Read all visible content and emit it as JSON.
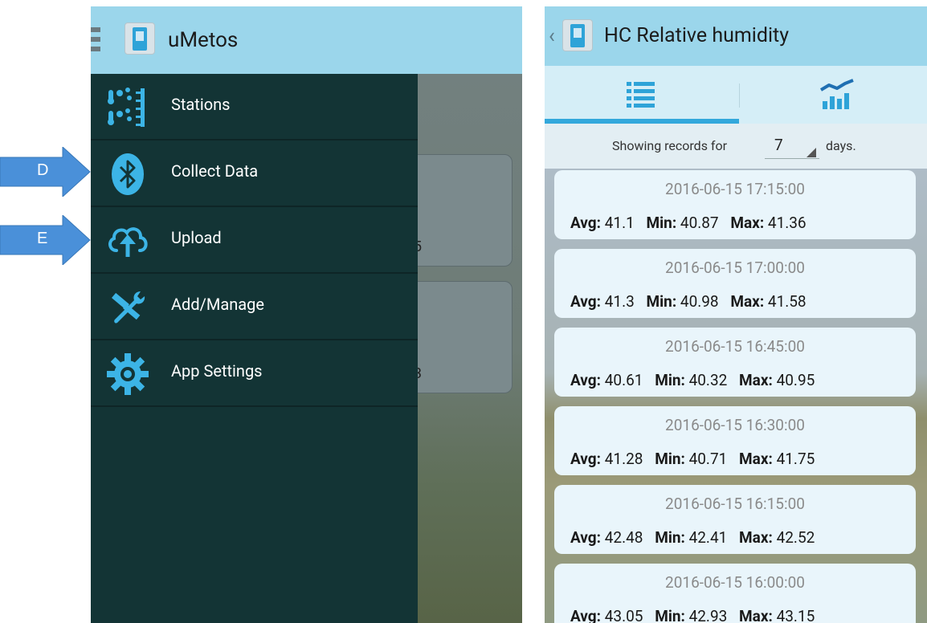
{
  "arrows": [
    {
      "letter": "D"
    },
    {
      "letter": "E"
    }
  ],
  "left_screen": {
    "app_title": "uMetos",
    "menu": [
      {
        "label": "Stations",
        "icon": "stations-icon"
      },
      {
        "label": "Collect Data",
        "icon": "bluetooth-icon"
      },
      {
        "label": "Upload",
        "icon": "cloud-upload-icon"
      },
      {
        "label": "Add/Manage",
        "icon": "tools-icon"
      },
      {
        "label": "App Settings",
        "icon": "gear-icon"
      }
    ],
    "bg_peek": [
      "5",
      "3"
    ]
  },
  "right_screen": {
    "title": "HC Relative humidity",
    "tabs": [
      {
        "icon": "list-icon",
        "active": true
      },
      {
        "icon": "chart-icon",
        "active": false
      }
    ],
    "filter": {
      "prefix": "Showing records for",
      "days": "7",
      "suffix": "days."
    },
    "labels": {
      "avg": "Avg:",
      "min": "Min:",
      "max": "Max:"
    },
    "records": [
      {
        "timestamp": "2016-06-15 17:15:00",
        "avg": "41.1",
        "min": "40.87",
        "max": "41.36"
      },
      {
        "timestamp": "2016-06-15 17:00:00",
        "avg": "41.3",
        "min": "40.98",
        "max": "41.58"
      },
      {
        "timestamp": "2016-06-15 16:45:00",
        "avg": "40.61",
        "min": "40.32",
        "max": "40.95"
      },
      {
        "timestamp": "2016-06-15 16:30:00",
        "avg": "41.28",
        "min": "40.71",
        "max": "41.75"
      },
      {
        "timestamp": "2016-06-15 16:15:00",
        "avg": "42.48",
        "min": "42.41",
        "max": "42.52"
      },
      {
        "timestamp": "2016-06-15 16:00:00",
        "avg": "43.05",
        "min": "42.93",
        "max": "43.15"
      }
    ]
  },
  "colors": {
    "app_bar": "#9bd6eb",
    "drawer": "#133435",
    "accent": "#33a8dc",
    "arrow": "#4a90d9"
  }
}
